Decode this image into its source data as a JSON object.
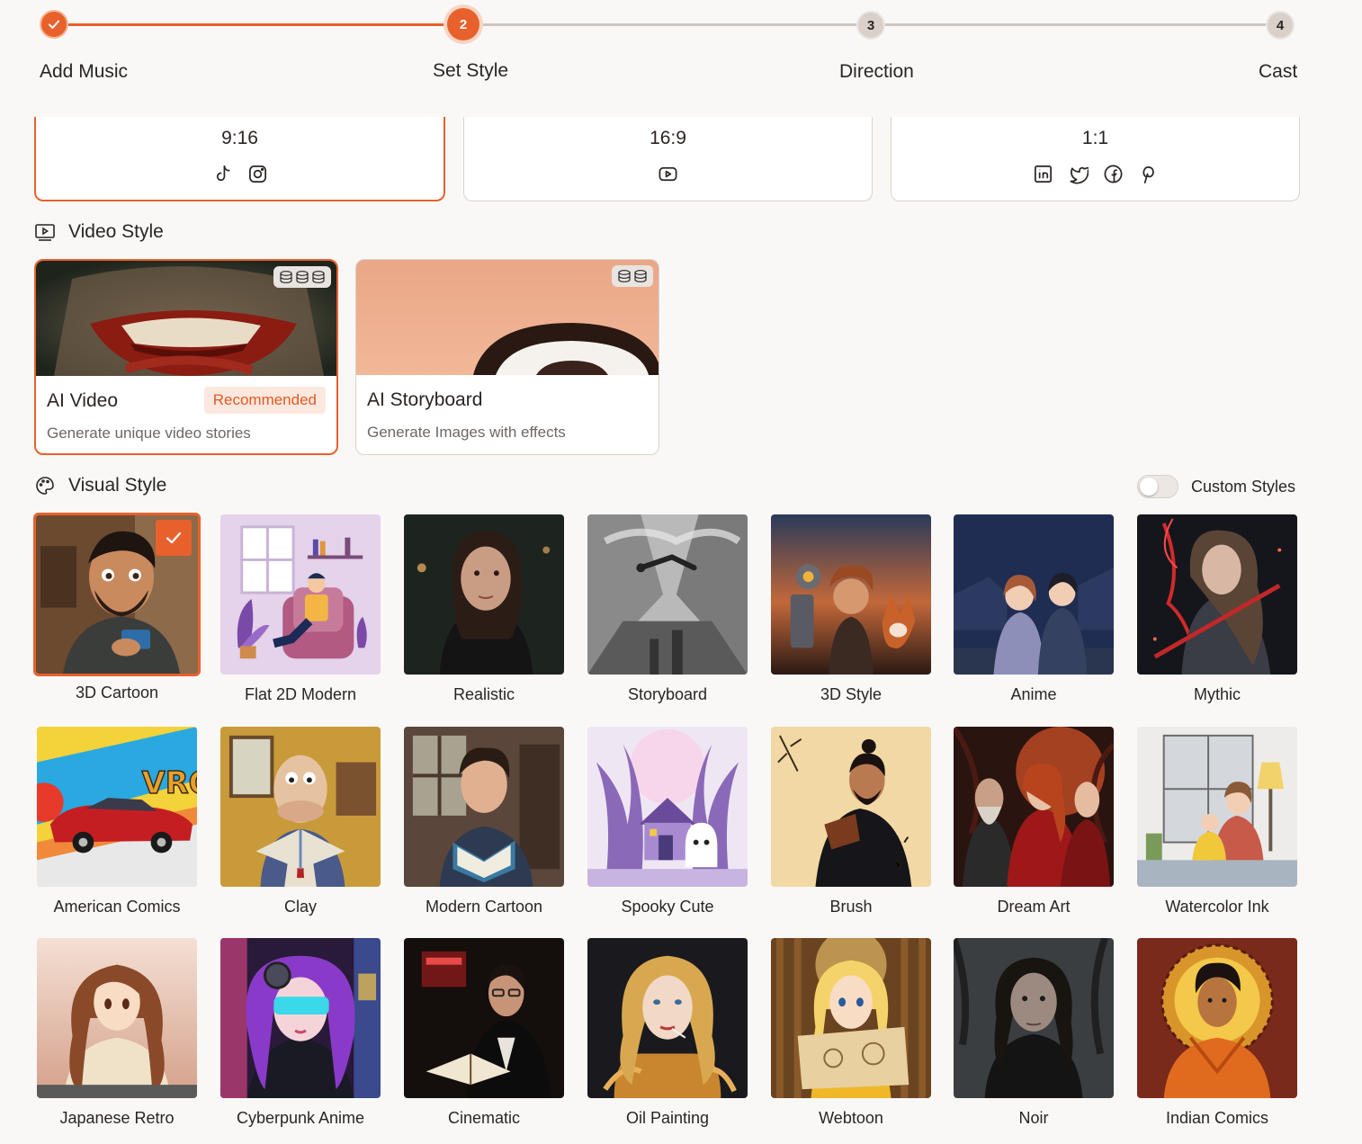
{
  "stepper": {
    "steps": [
      {
        "label": "Add Music",
        "number": ""
      },
      {
        "label": "Set Style",
        "number": "2"
      },
      {
        "label": "Direction",
        "number": "3"
      },
      {
        "label": "Cast",
        "number": "4"
      }
    ]
  },
  "ratios": [
    {
      "label": "9:16",
      "icons": [
        "tiktok-icon",
        "instagram-icon"
      ]
    },
    {
      "label": "16:9",
      "icons": [
        "youtube-icon"
      ]
    },
    {
      "label": "1:1",
      "icons": [
        "linkedin-icon",
        "twitter-icon",
        "facebook-icon",
        "pinterest-icon"
      ]
    }
  ],
  "video_style": {
    "heading": "Video Style",
    "cards": [
      {
        "title": "AI Video",
        "description": "Generate unique video stories",
        "badge": "Recommended"
      },
      {
        "title": "AI Storyboard",
        "description": "Generate Images with effects"
      }
    ]
  },
  "visual_style": {
    "heading": "Visual Style",
    "custom_toggle_label": "Custom Styles",
    "styles": [
      "3D Cartoon",
      "Flat 2D Modern",
      "Realistic",
      "Storyboard",
      "3D Style",
      "Anime",
      "Mythic",
      "American Comics",
      "Clay",
      "Modern Cartoon",
      "Spooky Cute",
      "Brush",
      "Dream Art",
      "Watercolor Ink",
      "Japanese Retro",
      "Cyberpunk Anime",
      "Cinematic",
      "Oil Painting",
      "Webtoon",
      "Noir",
      "Indian Comics"
    ]
  },
  "colors": {
    "accent": "#e8612c",
    "muted": "#6e6762",
    "border": "#d8d2cd"
  }
}
